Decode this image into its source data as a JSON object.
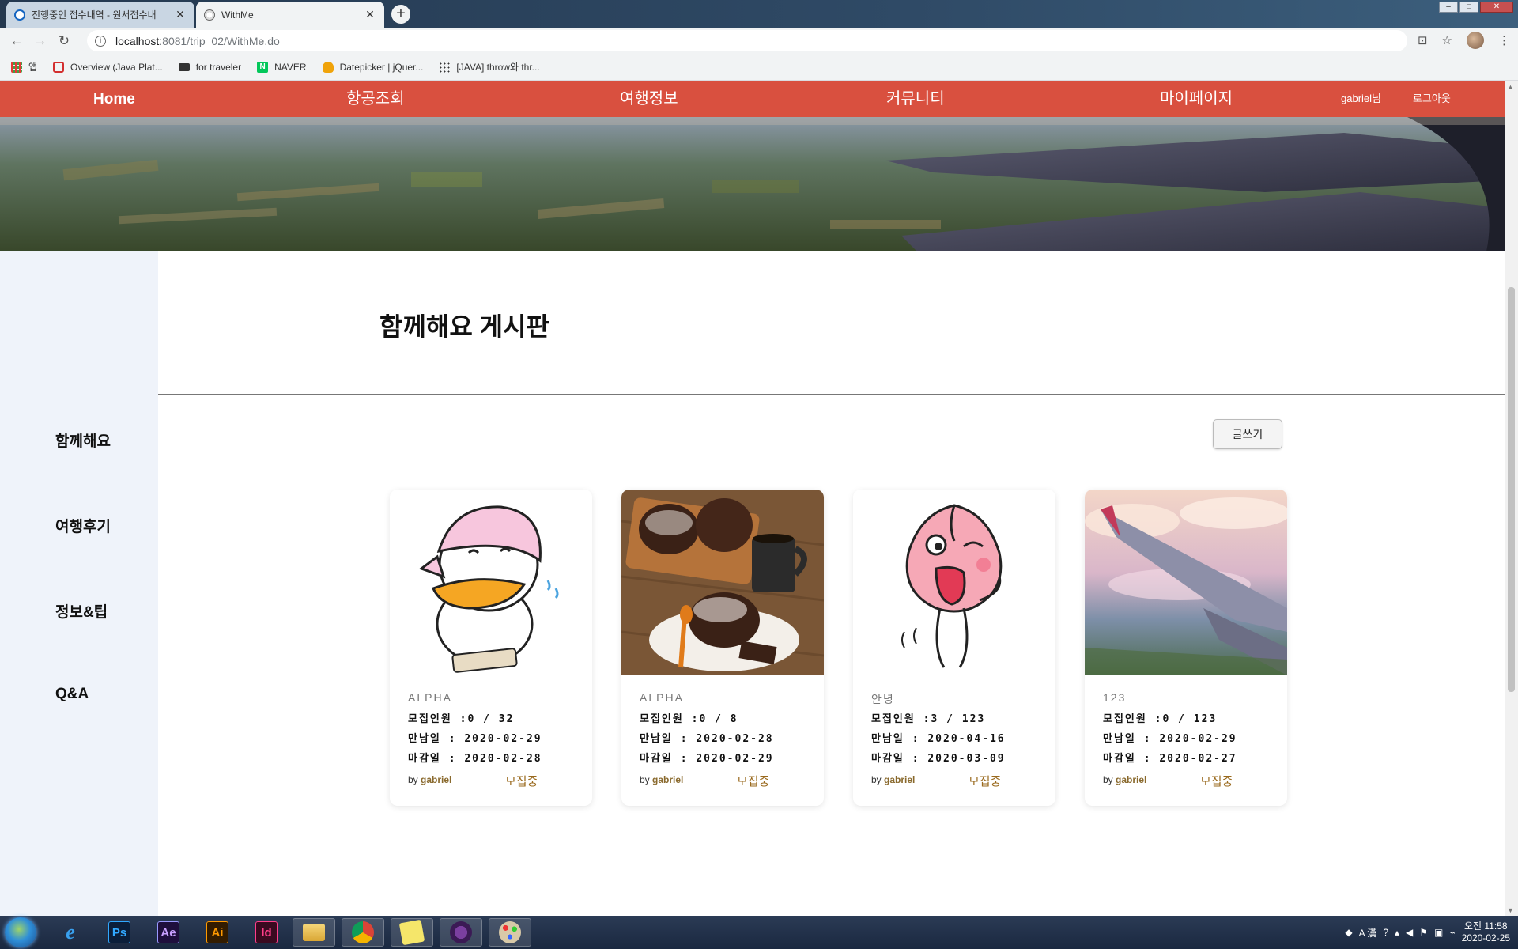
{
  "browser": {
    "tabs": [
      {
        "title": "진행중인 접수내역 - 원서접수내",
        "active": false
      },
      {
        "title": "WithMe",
        "active": true
      }
    ],
    "new_tab": "+",
    "url_host": "localhost",
    "url_path": ":8081/trip_02/WithMe.do",
    "bookmarks": [
      "앱",
      "Overview (Java Plat...",
      "for traveler",
      "NAVER",
      "Datepicker | jQuer...",
      "[JAVA] throw와 thr..."
    ]
  },
  "nav": {
    "home": "Home",
    "items": [
      "항공조회",
      "여행정보",
      "커뮤니티",
      "마이페이지"
    ],
    "user": "gabriel님",
    "logout": "로그아웃"
  },
  "sidebar": {
    "items": [
      "함께해요",
      "여행후기",
      "정보&팁",
      "Q&A"
    ]
  },
  "board": {
    "title": "함께해요 게시판",
    "write_label": "글쓰기"
  },
  "cards": [
    {
      "title": "ALPHA",
      "recruit": "모집인원 :0 / 32",
      "meet": "만남일 : 2020-02-29",
      "deadline": "마감일 : 2020-02-28",
      "by": "by",
      "author": "gabriel",
      "status": "모집중"
    },
    {
      "title": "ALPHA",
      "recruit": "모집인원 :0 / 8",
      "meet": "만남일 : 2020-02-28",
      "deadline": "마감일 : 2020-02-29",
      "by": "by",
      "author": "gabriel",
      "status": "모집중"
    },
    {
      "title": "안녕",
      "recruit": "모집인원 :3 / 123",
      "meet": "만남일 : 2020-04-16",
      "deadline": "마감일 : 2020-03-09",
      "by": "by",
      "author": "gabriel",
      "status": "모집중"
    },
    {
      "title": "123",
      "recruit": "모집인원 :0 / 123",
      "meet": "만남일 : 2020-02-29",
      "deadline": "마감일 : 2020-02-27",
      "by": "by",
      "author": "gabriel",
      "status": "모집중"
    }
  ],
  "taskbar": {
    "apps": [
      "Ps",
      "Ae",
      "Ai",
      "Id"
    ],
    "ime": "A 漢",
    "time": "오전 11:58",
    "date": "2020-02-25"
  },
  "colors": {
    "nav_bg": "#d9503f",
    "sidebar_bg": "#eff3fa",
    "status": "#9a6a1e"
  }
}
